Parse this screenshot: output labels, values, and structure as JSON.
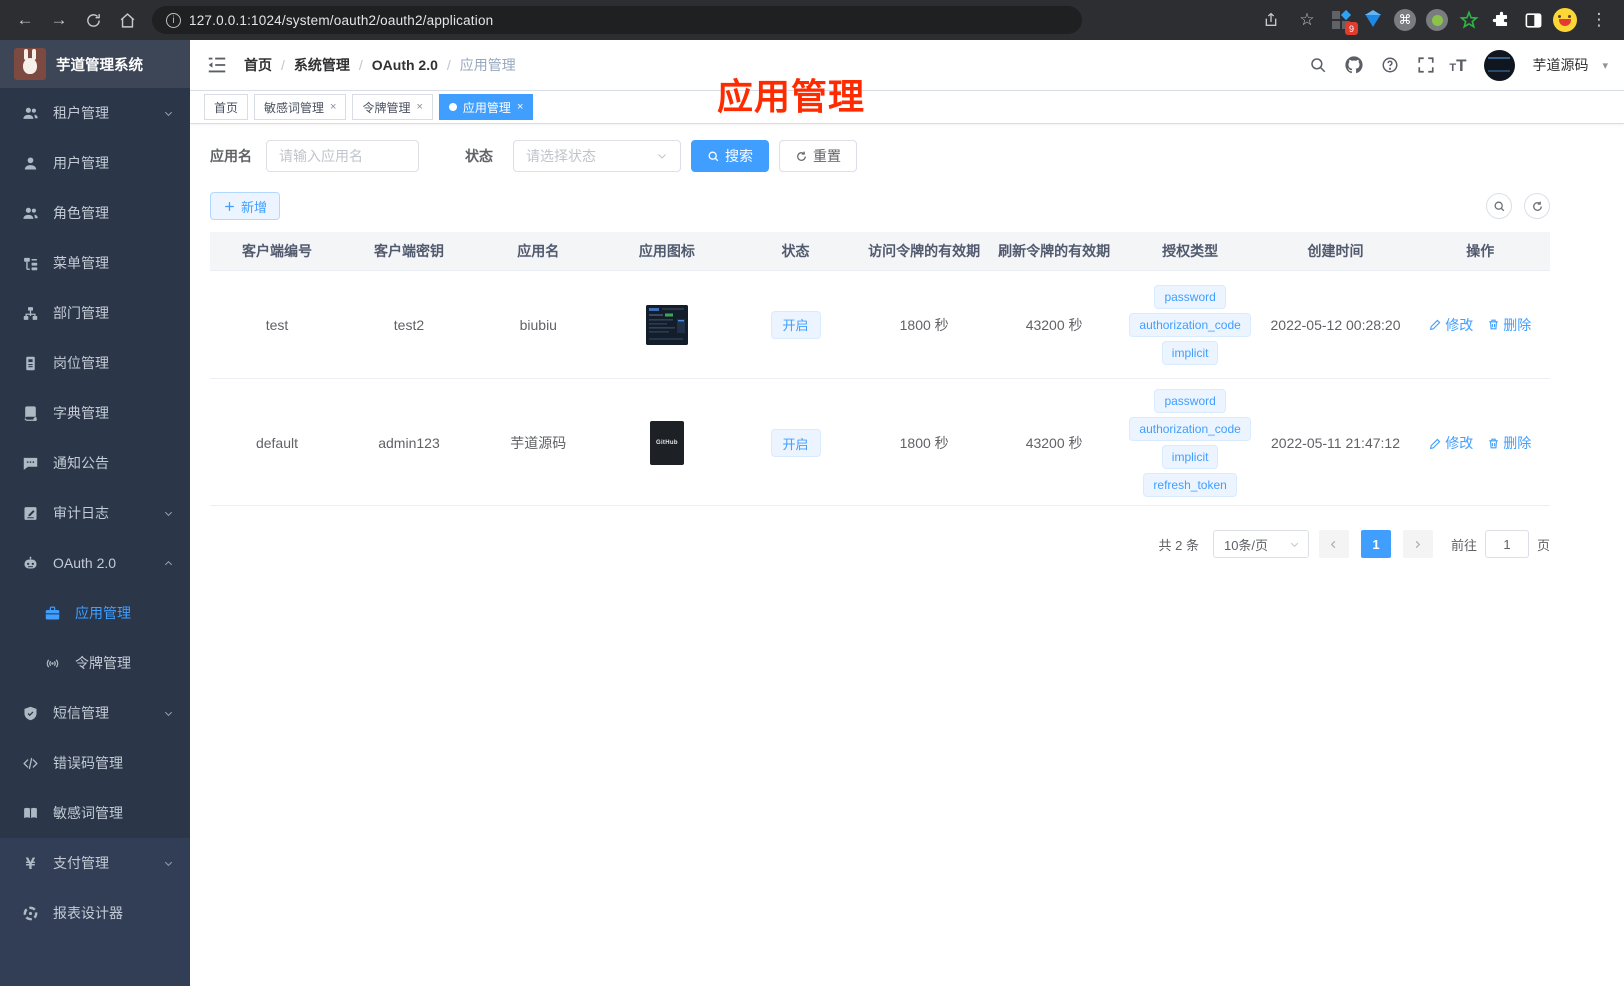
{
  "browser": {
    "url": "127.0.0.1:1024/system/oauth2/oauth2/application",
    "extension_badge": "9"
  },
  "sidebar": {
    "app_title": "芋道管理系统",
    "menu": [
      {
        "label": "租户管理",
        "icon": "users-icon",
        "arrow": "down",
        "section": "upper"
      },
      {
        "label": "用户管理",
        "icon": "user-icon",
        "section": "upper"
      },
      {
        "label": "角色管理",
        "icon": "users-icon",
        "section": "upper"
      },
      {
        "label": "菜单管理",
        "icon": "tree-icon",
        "section": "upper"
      },
      {
        "label": "部门管理",
        "icon": "org-icon",
        "section": "upper"
      },
      {
        "label": "岗位管理",
        "icon": "badge-icon",
        "section": "upper"
      },
      {
        "label": "字典管理",
        "icon": "dict-icon",
        "section": "upper"
      },
      {
        "label": "通知公告",
        "icon": "notice-icon",
        "section": "upper"
      },
      {
        "label": "审计日志",
        "icon": "log-icon",
        "arrow": "down",
        "section": "upper"
      },
      {
        "label": "OAuth 2.0",
        "icon": "robot-icon",
        "arrow": "up",
        "section": "upper"
      },
      {
        "label": "应用管理",
        "icon": "briefcase-icon",
        "sub": true,
        "active": true,
        "section": "upper"
      },
      {
        "label": "令牌管理",
        "icon": "token-icon",
        "sub": true,
        "section": "upper"
      },
      {
        "label": "短信管理",
        "icon": "shield-icon",
        "arrow": "down",
        "section": "upper"
      },
      {
        "label": "错误码管理",
        "icon": "code-icon",
        "section": "upper"
      },
      {
        "label": "敏感词管理",
        "icon": "openbook-icon",
        "section": "upper"
      },
      {
        "label": "支付管理",
        "icon": "yen-icon",
        "arrow": "down",
        "section": "lower"
      },
      {
        "label": "报表设计器",
        "icon": "target-icon",
        "section": "lower"
      }
    ]
  },
  "navbar": {
    "breadcrumb": [
      "首页",
      "系统管理",
      "OAuth 2.0",
      "应用管理"
    ],
    "username": "芋道源码"
  },
  "tabs": [
    {
      "label": "首页",
      "closable": false,
      "active": false
    },
    {
      "label": "敏感词管理",
      "closable": true,
      "active": false
    },
    {
      "label": "令牌管理",
      "closable": true,
      "active": false
    },
    {
      "label": "应用管理",
      "closable": true,
      "active": true
    }
  ],
  "annotation": {
    "text": "应用管理"
  },
  "filters": {
    "name_label": "应用名",
    "name_placeholder": "请输入应用名",
    "status_label": "状态",
    "status_placeholder": "请选择状态",
    "search_label": "搜索",
    "reset_label": "重置",
    "add_label": "新增"
  },
  "table": {
    "headers": [
      "客户端编号",
      "客户端密钥",
      "应用名",
      "应用图标",
      "状态",
      "访问令牌的有效期",
      "刷新令牌的有效期",
      "授权类型",
      "创建时间",
      "操作"
    ],
    "edit_label": "修改",
    "delete_label": "删除",
    "rows": [
      {
        "client_id": "test",
        "client_secret": "test2",
        "app_name": "biubiu",
        "icon_style": "screenshot",
        "icon_label": "",
        "status": "开启",
        "access_ttl": "1800 秒",
        "refresh_ttl": "43200 秒",
        "grants": [
          "password",
          "authorization_code",
          "implicit"
        ],
        "created": "2022-05-12 00:28:20"
      },
      {
        "client_id": "default",
        "client_secret": "admin123",
        "app_name": "芋道源码",
        "icon_style": "github",
        "icon_label": "GitHub",
        "status": "开启",
        "access_ttl": "1800 秒",
        "refresh_ttl": "43200 秒",
        "grants": [
          "password",
          "authorization_code",
          "implicit",
          "refresh_token"
        ],
        "created": "2022-05-11 21:47:12"
      }
    ]
  },
  "pagination": {
    "total": "共 2 条",
    "page_size": "10条/页",
    "current_page": "1",
    "goto_label": "前往",
    "goto_value": "1",
    "page_unit": "页"
  },
  "colors": {
    "accent": "#409eff",
    "annotation_red": "#ff2b00",
    "tag_bg": "#ecf5ff"
  }
}
